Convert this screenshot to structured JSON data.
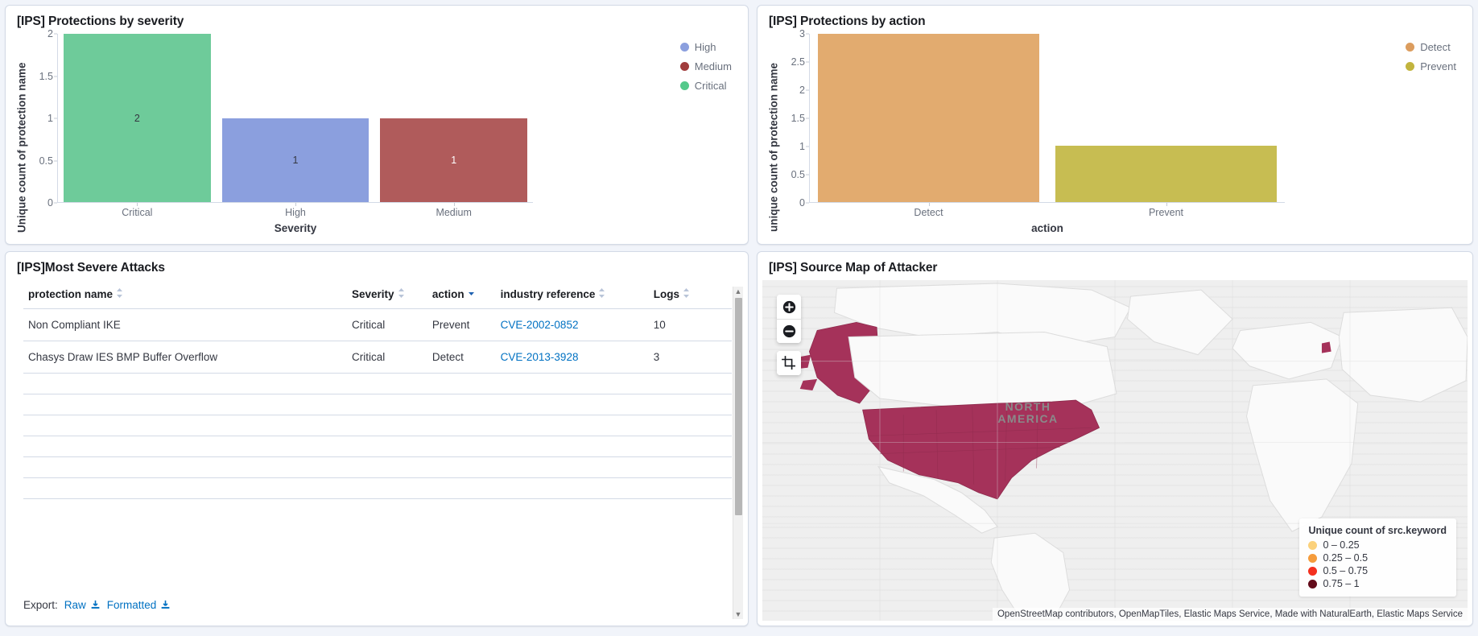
{
  "panels": {
    "severity": {
      "title": "[IPS] Protections by severity"
    },
    "action": {
      "title": "[IPS] Protections by action"
    },
    "table": {
      "title": "[IPS]Most Severe Attacks"
    },
    "map": {
      "title": "[IPS] Source Map of Attacker"
    }
  },
  "chart_data": [
    {
      "type": "bar",
      "title": "[IPS] Protections by severity",
      "categories": [
        "Critical",
        "High",
        "Medium"
      ],
      "values": [
        2,
        1,
        1
      ],
      "bar_labels": [
        "2",
        "1",
        "1"
      ],
      "colors": [
        "#6ecb9a",
        "#8b9fde",
        "#b05b5b"
      ],
      "xlabel": "Severity",
      "ylabel": "Unique count of protection name",
      "ylim": [
        0,
        2
      ],
      "yticks": [
        "0",
        "0.5",
        "1",
        "1.5",
        "2"
      ],
      "grid": false,
      "legend_position": "right",
      "legend": [
        {
          "label": "High",
          "color": "#8b9fde"
        },
        {
          "label": "Medium",
          "color": "#b05b5b"
        },
        {
          "label": "Critical",
          "color": "#6ecb9a"
        }
      ]
    },
    {
      "type": "bar",
      "title": "[IPS] Protections by action",
      "categories": [
        "Detect",
        "Prevent"
      ],
      "values": [
        3,
        1
      ],
      "bar_labels": [
        "",
        ""
      ],
      "colors": [
        "#e2ab6f",
        "#c7bd52"
      ],
      "xlabel": "action",
      "ylabel": "unique count of protection name",
      "ylim": [
        0,
        3
      ],
      "yticks": [
        "0",
        "0.5",
        "1",
        "1.5",
        "2",
        "2.5",
        "3"
      ],
      "grid": false,
      "legend_position": "right",
      "legend": [
        {
          "label": "Detect",
          "color": "#e2ab6f"
        },
        {
          "label": "Prevent",
          "color": "#c7bd52"
        }
      ]
    }
  ],
  "table": {
    "columns": [
      {
        "label": "protection name",
        "sort": "both"
      },
      {
        "label": "Severity",
        "sort": "both"
      },
      {
        "label": "action",
        "sort": "desc"
      },
      {
        "label": "industry reference",
        "sort": "both"
      },
      {
        "label": "Logs",
        "sort": "both"
      }
    ],
    "rows": [
      {
        "protection_name": "Non Compliant IKE",
        "severity": "Critical",
        "action": "Prevent",
        "industry_reference": "CVE-2002-0852",
        "logs": "10"
      },
      {
        "protection_name": "Chasys Draw IES BMP Buffer Overflow",
        "severity": "Critical",
        "action": "Detect",
        "industry_reference": "CVE-2013-3928",
        "logs": "3"
      }
    ],
    "empty_row_count": 7,
    "export": {
      "label": "Export:",
      "raw": "Raw",
      "formatted": "Formatted"
    }
  },
  "map": {
    "legend_title": "Unique count of src.keyword",
    "legend_bins": [
      {
        "label": "0 – 0.25",
        "color": "#fbd17b"
      },
      {
        "label": "0.25 – 0.5",
        "color": "#f59c3c"
      },
      {
        "label": "0.5 – 0.75",
        "color": "#f4301e"
      },
      {
        "label": "0.75 – 1",
        "color": "#630b1a"
      }
    ],
    "continent_label": "NORTH AMERICA",
    "attribution": "OpenStreetMap contributors, OpenMapTiles, Elastic Maps Service, Made with NaturalEarth, Elastic Maps Service",
    "controls": {
      "zoom_in": "+",
      "zoom_out": "−"
    },
    "highlight_color": "#a5325a"
  }
}
